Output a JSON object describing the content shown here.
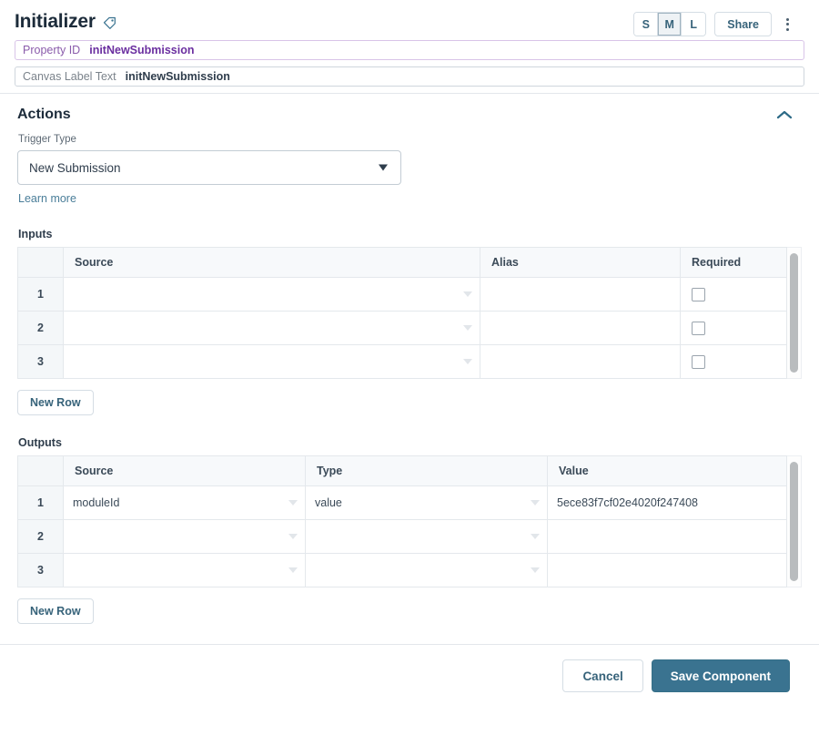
{
  "header": {
    "title": "Initializer",
    "tag_icon": "tag-icon",
    "size_options": [
      {
        "label": "S",
        "active": false
      },
      {
        "label": "M",
        "active": true
      },
      {
        "label": "L",
        "active": false
      }
    ],
    "share_label": "Share",
    "kebab_icon": "more-vertical-icon"
  },
  "fields": [
    {
      "label": "Property ID",
      "value": "initNewSubmission",
      "accent": "purple"
    },
    {
      "label": "Canvas Label Text",
      "value": "initNewSubmission",
      "accent": "default"
    }
  ],
  "actions": {
    "title": "Actions",
    "collapse_icon": "chevron-up-icon",
    "trigger_type_label": "Trigger Type",
    "trigger_type_value": "New Submission",
    "learn_more_label": "Learn more"
  },
  "inputs": {
    "label": "Inputs",
    "columns": [
      "",
      "Source",
      "Alias",
      "Required"
    ],
    "rows": [
      {
        "index": "1",
        "source": "",
        "alias": "",
        "required": false
      },
      {
        "index": "2",
        "source": "",
        "alias": "",
        "required": false
      },
      {
        "index": "3",
        "source": "",
        "alias": "",
        "required": false
      }
    ],
    "new_row_label": "New Row"
  },
  "outputs": {
    "label": "Outputs",
    "columns": [
      "",
      "Source",
      "Type",
      "Value"
    ],
    "rows": [
      {
        "index": "1",
        "source": "moduleId",
        "type": "value",
        "value": "5ece83f7cf02e4020f247408"
      },
      {
        "index": "2",
        "source": "",
        "type": "",
        "value": ""
      },
      {
        "index": "3",
        "source": "",
        "type": "",
        "value": ""
      }
    ],
    "new_row_label": "New Row"
  },
  "footer": {
    "cancel_label": "Cancel",
    "save_label": "Save Component"
  },
  "colors": {
    "accent_teal": "#3a7390",
    "link_teal": "#4a7e99",
    "purple": "#6b2fa0",
    "header_bg": "#f7f9fb"
  }
}
